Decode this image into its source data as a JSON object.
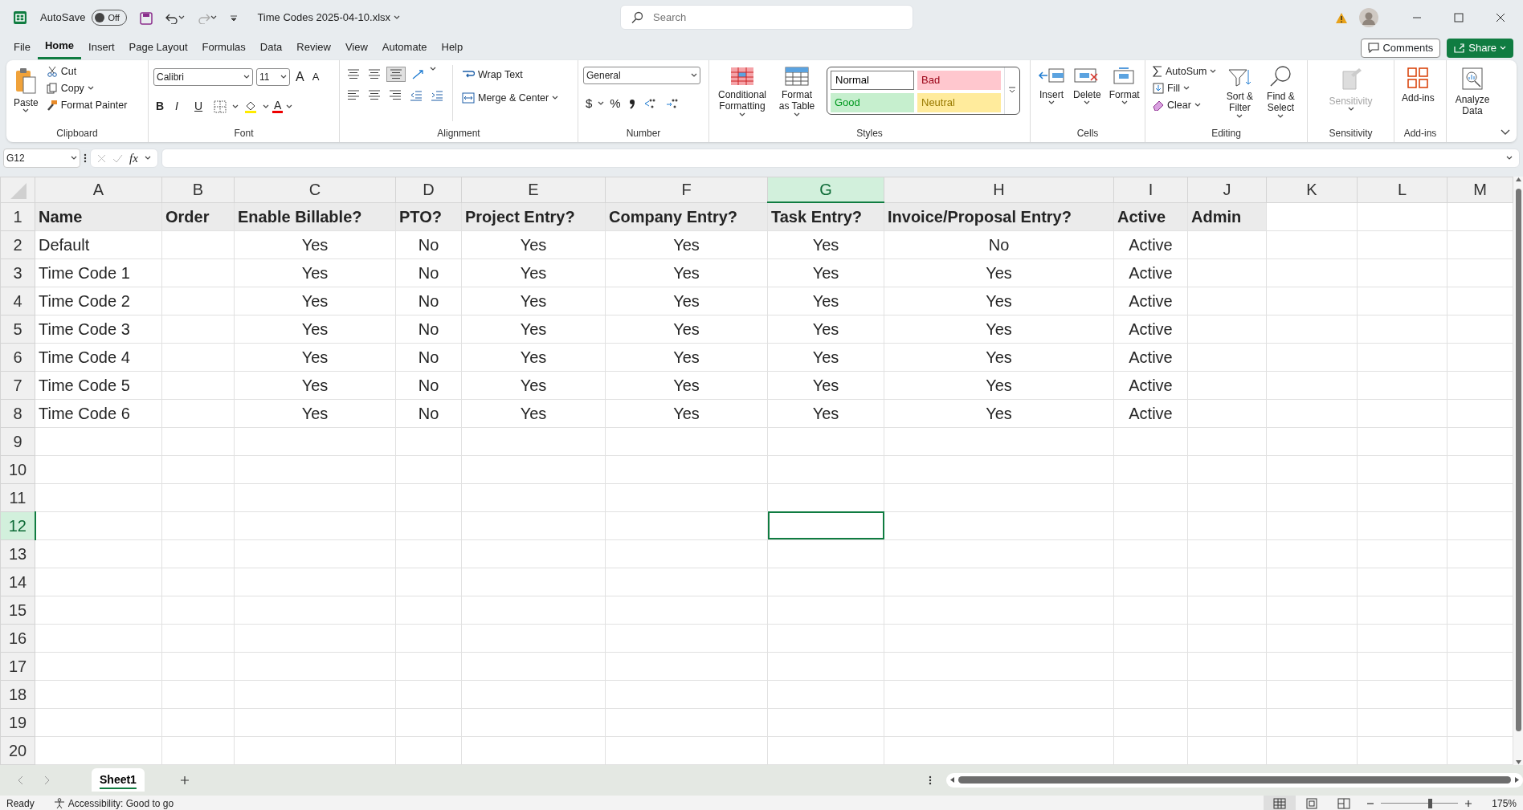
{
  "window": {
    "title": "Time Codes 2025-04-10.xlsx",
    "autosave_label": "AutoSave",
    "autosave": {
      "on": false,
      "text": "Off"
    }
  },
  "search": {
    "placeholder": "Search"
  },
  "menu_tabs": [
    {
      "label": "File",
      "selected": false
    },
    {
      "label": "Home",
      "selected": true
    },
    {
      "label": "Insert",
      "selected": false
    },
    {
      "label": "Page Layout",
      "selected": false
    },
    {
      "label": "Formulas",
      "selected": false
    },
    {
      "label": "Data",
      "selected": false
    },
    {
      "label": "Review",
      "selected": false
    },
    {
      "label": "View",
      "selected": false
    },
    {
      "label": "Automate",
      "selected": false
    },
    {
      "label": "Help",
      "selected": false
    }
  ],
  "header_buttons": {
    "comments": "Comments",
    "share": "Share"
  },
  "ribbon": {
    "clipboard": {
      "label": "Clipboard",
      "paste": "Paste",
      "items": [
        "Cut",
        "Copy",
        "Format Painter"
      ]
    },
    "font": {
      "label": "Font",
      "name": "Calibri",
      "size": "11",
      "grow": "A",
      "shrink": "A",
      "styles": [
        "B",
        "I",
        "U"
      ],
      "font_color": "A"
    },
    "alignment": {
      "label": "Alignment",
      "wrap": "Wrap Text",
      "merge": "Merge & Center"
    },
    "number": {
      "label": "Number",
      "format": "General",
      "currency": "$",
      "percent": "%"
    },
    "styles": {
      "label": "Styles",
      "conditional": "Conditional Formatting",
      "format_table": "Format as Table",
      "gallery": [
        {
          "label": "Normal",
          "color": "#ffffff"
        },
        {
          "label": "Bad",
          "color": "#ffc7ce"
        },
        {
          "label": "Good",
          "color": "#c6efce"
        },
        {
          "label": "Neutral",
          "color": "#ffeb9c"
        }
      ]
    },
    "cells": {
      "label": "Cells",
      "buttons": [
        "Insert",
        "Delete",
        "Format"
      ]
    },
    "editing": {
      "label": "Editing",
      "items": [
        "AutoSum",
        "Fill",
        "Clear"
      ],
      "sort": "Sort & Filter",
      "find": "Find & Select"
    },
    "sensitivity": {
      "label": "Sensitivity",
      "button": "Sensitivity",
      "disabled": true
    },
    "addins": {
      "label": "Add-ins",
      "button": "Add-ins"
    },
    "analyze": {
      "button": "Analyze Data"
    }
  },
  "formula_bar": {
    "name_box": "G12",
    "fx": "fx"
  },
  "sheet": {
    "columns": [
      {
        "label": "A",
        "selected": false
      },
      {
        "label": "B",
        "selected": false
      },
      {
        "label": "C",
        "selected": false
      },
      {
        "label": "D",
        "selected": false
      },
      {
        "label": "E",
        "selected": false
      },
      {
        "label": "F",
        "selected": false
      },
      {
        "label": "G",
        "selected": true
      },
      {
        "label": "H",
        "selected": false
      },
      {
        "label": "I",
        "selected": false
      },
      {
        "label": "J",
        "selected": false
      },
      {
        "label": "K",
        "selected": false
      },
      {
        "label": "L",
        "selected": false
      },
      {
        "label": "M",
        "selected": false
      }
    ],
    "rows": [
      {
        "label": "1",
        "selected": false,
        "kind": "header",
        "cells": [
          "Name",
          "Order",
          "Enable Billable?",
          "PTO?",
          "Project Entry?",
          "Company Entry?",
          "Task Entry?",
          "Invoice/Proposal Entry?",
          "Active",
          "Admin"
        ]
      },
      {
        "label": "2",
        "selected": false,
        "kind": "data",
        "cells": [
          "Default",
          null,
          "Yes",
          "No",
          "Yes",
          "Yes",
          "Yes",
          "No",
          "Active",
          null
        ]
      },
      {
        "label": "3",
        "selected": false,
        "kind": "data",
        "cells": [
          "Time Code 1",
          null,
          "Yes",
          "No",
          "Yes",
          "Yes",
          "Yes",
          "Yes",
          "Active",
          null
        ]
      },
      {
        "label": "4",
        "selected": false,
        "kind": "data",
        "cells": [
          "Time Code 2",
          null,
          "Yes",
          "No",
          "Yes",
          "Yes",
          "Yes",
          "Yes",
          "Active",
          null
        ]
      },
      {
        "label": "5",
        "selected": false,
        "kind": "data",
        "cells": [
          "Time Code 3",
          null,
          "Yes",
          "No",
          "Yes",
          "Yes",
          "Yes",
          "Yes",
          "Active",
          null
        ]
      },
      {
        "label": "6",
        "selected": false,
        "kind": "data",
        "cells": [
          "Time Code 4",
          null,
          "Yes",
          "No",
          "Yes",
          "Yes",
          "Yes",
          "Yes",
          "Active",
          null
        ]
      },
      {
        "label": "7",
        "selected": false,
        "kind": "data",
        "cells": [
          "Time Code 5",
          null,
          "Yes",
          "No",
          "Yes",
          "Yes",
          "Yes",
          "Yes",
          "Active",
          null
        ]
      },
      {
        "label": "8",
        "selected": false,
        "kind": "data",
        "cells": [
          "Time Code 6",
          null,
          "Yes",
          "No",
          "Yes",
          "Yes",
          "Yes",
          "Yes",
          "Active",
          null
        ]
      },
      {
        "label": "9",
        "selected": false
      },
      {
        "label": "10",
        "selected": false
      },
      {
        "label": "11",
        "selected": false
      },
      {
        "label": "12",
        "selected": true
      },
      {
        "label": "13",
        "selected": false
      },
      {
        "label": "14",
        "selected": false
      },
      {
        "label": "15",
        "selected": false
      },
      {
        "label": "16",
        "selected": false
      },
      {
        "label": "17",
        "selected": false
      },
      {
        "label": "18",
        "selected": false
      },
      {
        "label": "19",
        "selected": false
      },
      {
        "label": "20",
        "selected": false
      }
    ]
  },
  "sheet_tabs": [
    {
      "label": "Sheet1",
      "selected": true
    }
  ],
  "status_bar": {
    "ready": "Ready",
    "accessibility": "Accessibility: Good to go",
    "views": [
      {
        "selected": true
      },
      {
        "selected": false
      },
      {
        "selected": false
      }
    ],
    "zoom": {
      "level": 0.63,
      "text": "175%"
    }
  }
}
